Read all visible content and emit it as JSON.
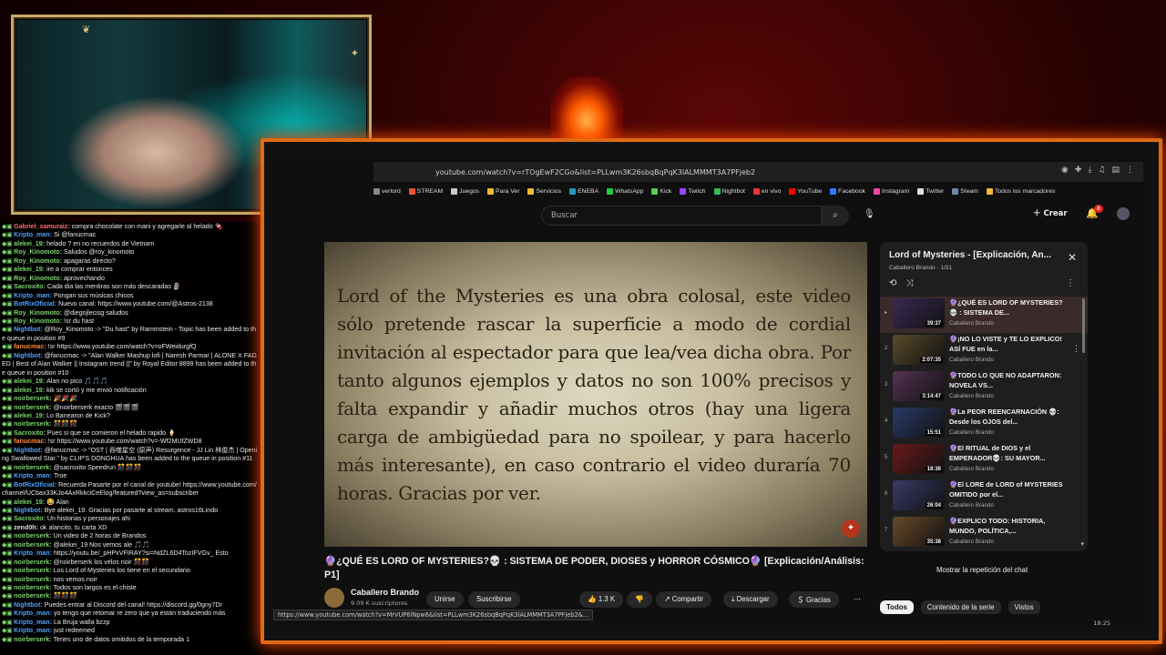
{
  "colors": {
    "accent_border": "#e06a14",
    "yt_red": "#e62117",
    "chat_badge": "#7dd36e"
  },
  "browser": {
    "url": "youtube.com/watch?v=rTOgEwF2CGo&list=PLLwm3K26sbqBqPqK3lALMMMT3A7PFjeb2",
    "bookmarks": [
      "verlord",
      "STREAM",
      "Juegos",
      "Para Ver",
      "Servicios",
      "ENEBA",
      "WhatsApp",
      "Kick",
      "Twitch",
      "Nightbot",
      "en vivo",
      "YouTube",
      "Facebook",
      "Instagram",
      "Twitter",
      "Steam",
      "Todos los marcadores"
    ],
    "status_url": "https://www.youtube.com/watch?v=MrVUP6lNpw6&list=PLLwm3K26sbqBqPqK3lALMMMT3A7PFjeb2&...",
    "clock": "18:25"
  },
  "yt": {
    "search_placeholder": "Buscar",
    "create_label": "Crear",
    "notif_count": "8",
    "video_overlay_text": "Lord of the Mysteries es una obra colosal, este video sólo pretende rascar la superficie a modo de cordial invitación al espectador para que lea/vea dicha obra. Por tanto algunos ejemplos y datos no son 100% precisos y falta expandir y añadir muchos otros (hay una ligera carga de ambigüedad para no spoilear, y para hacerlo más interesante), en caso contrario el video duraría 70 horas. Gracias por ver.",
    "video_title": "🔮¿QUÉ ES LORD OF MYSTERIES?💀 : SISTEMA DE PODER, DIOSES y HORROR CÓSMICO🔮 [Explicación/Análisis: P1]",
    "channel": "Caballero Brando",
    "subscribers": "9.09 K suscriptores",
    "join_label": "Unirse",
    "subscribe_label": "Suscribirse",
    "likes": "1.3 K",
    "share_label": "Compartir",
    "download_label": "Descargar",
    "thanks_label": "Gracias",
    "chat_replay_label": "Mostrar la repetición del chat",
    "chips": [
      "Todos",
      "Contenido de la serie",
      "Vistos"
    ]
  },
  "playlist": {
    "title": "Lord of Mysteries - [Explicación, An...",
    "subtitle": "Caballero Brando - 1/31",
    "items": [
      {
        "idx": "▸",
        "title": "🔮¿QUÉ ES LORD OF MYSTERIES?💀 : SISTEMA DE...",
        "channel": "Caballero Brando",
        "duration": "39:37",
        "thumb": "#3a2a55"
      },
      {
        "idx": "2",
        "title": "🔮¡NO LO VISTE y TE LO EXPLICO! ASÍ FUE en la...",
        "channel": "Caballero Brando",
        "duration": "2:07:35",
        "thumb": "#5a4a2a"
      },
      {
        "idx": "3",
        "title": "🔮TODO LO QUE NO ADAPTARON: NOVELA VS...",
        "channel": "Caballero Brando",
        "duration": "3:14:47",
        "thumb": "#553355"
      },
      {
        "idx": "4",
        "title": "🔮La PEOR REENCARNACIÓN 💀: Desde los OJOS del...",
        "channel": "Caballero Brando",
        "duration": "15:51",
        "thumb": "#2a3a66"
      },
      {
        "idx": "5",
        "title": "🔮El RITUAL de DIOS y el EMPERADOR💀: SU MAYOR...",
        "channel": "Caballero Brando",
        "duration": "18:36",
        "thumb": "#6a1a1a"
      },
      {
        "idx": "6",
        "title": "🔮El LORE de LORD of MYSTERIES OMITIDO por el...",
        "channel": "Caballero Brando",
        "duration": "26:04",
        "thumb": "#3a3a6a"
      },
      {
        "idx": "7",
        "title": "🔮EXPLICO TODO: HISTORIA, MUNDO, POLÍTICA,...",
        "channel": "Caballero Brando",
        "duration": "35:38",
        "thumb": "#6a4a2a"
      }
    ]
  },
  "chat": [
    {
      "user": "Gabriel_samuraiz:",
      "color": "#ff6a6a",
      "msg": "compra chocolate con mani y agregarle al helado 🍫"
    },
    {
      "user": "Kripto_man:",
      "color": "#4ea3ff",
      "msg": "Si @fanucmac"
    },
    {
      "user": "alekei_19:",
      "color": "#7dd36e",
      "msg": "helado ? en no recuerdos de Vietnam"
    },
    {
      "user": "Roy_Kinomoto:",
      "color": "#7dd36e",
      "msg": "Saludos @roy_kinomoto"
    },
    {
      "user": "Roy_Kinomoto:",
      "color": "#7dd36e",
      "msg": "apagaras directo?"
    },
    {
      "user": "alekei_19:",
      "color": "#7dd36e",
      "msg": "ire a comprar entonces"
    },
    {
      "user": "Roy_Kinomoto:",
      "color": "#7dd36e",
      "msg": "aprovechando"
    },
    {
      "user": "Sacroxito:",
      "color": "#7dd36e",
      "msg": "Cada dia las mentiras son más descaradas 🗿"
    },
    {
      "user": "Kripto_man:",
      "color": "#4ea3ff",
      "msg": "Pongan sus músicas chicos"
    },
    {
      "user": "BotRixOficial:",
      "color": "#4ea3ff",
      "msg": "Nuevo canal: https://www.youtube.com/@Astros-2138"
    },
    {
      "user": "Roy_Kinomoto:",
      "color": "#7dd36e",
      "msg": "@diegojlecisg saludos"
    },
    {
      "user": "Roy_Kinomoto:",
      "color": "#7dd36e",
      "msg": "!sr du hast"
    },
    {
      "user": "Nightbot:",
      "color": "#4ea3ff",
      "msg": "@Roy_Kinomoto -> \"Du hast\" by Rammstein - Topic has been added to the queue in position #9"
    },
    {
      "user": "fanucmac:",
      "color": "#ff8a3a",
      "msg": "!sr https://www.youtube.com/watch?v=oFWeidurgfQ"
    },
    {
      "user": "Nightbot:",
      "color": "#4ea3ff",
      "msg": "@fanucmac -> \"Alan Walker Mashup lofi | Naresh Parmar | ALONE X FADED | Best of Alan Walker || Instagram trend ||\" by Royal Editor 8899 has been added to the queue in position #10"
    },
    {
      "user": "alekei_19:",
      "color": "#7dd36e",
      "msg": "Alan no pico 🎵🎵🎵"
    },
    {
      "user": "alekei_19:",
      "color": "#7dd36e",
      "msg": "kik se cortó y me envió notificación"
    },
    {
      "user": "noirberserk:",
      "color": "#7dd36e",
      "msg": "🎉🎉🎉"
    },
    {
      "user": "noirberserk:",
      "color": "#7dd36e",
      "msg": "@noirberserk exacto 🎬🎬🎬"
    },
    {
      "user": "alekei_19:",
      "color": "#7dd36e",
      "msg": "Lo Banearon de Kick?"
    },
    {
      "user": "noirberserk:",
      "color": "#7dd36e",
      "msg": "🎊🎊🎊"
    },
    {
      "user": "Sacroxito:",
      "color": "#7dd36e",
      "msg": "Pues si que se comieron el helado rapido 🍦"
    },
    {
      "user": "fanucmac:",
      "color": "#ff8a3a",
      "msg": "!sr https://www.youtube.com/watch?v=-Wf2MUfZWD8"
    },
    {
      "user": "Nightbot:",
      "color": "#4ea3ff",
      "msg": "@fanucmac -> \"OST | 吞噬星空 (原声) Resurgence - JJ Lin 林俊杰 | Opening Swallowed Star.\" by CLIP'S DONGHUA has been added to the queue in position #11"
    },
    {
      "user": "noirberserk:",
      "color": "#7dd36e",
      "msg": "@sacroxito Speedrun 🎊🎊🎊"
    },
    {
      "user": "Kripto_man:",
      "color": "#4ea3ff",
      "msg": "Troe"
    },
    {
      "user": "BotRixOficial:",
      "color": "#4ea3ff",
      "msg": "Recuerda Pasarte por el canal de youtube! https://www.youtube.com/channel/UCbax33KJo4AxRkkciCeElog/featured?view_as=subscriber"
    },
    {
      "user": "alekei_19:",
      "color": "#7dd36e",
      "msg": "😂 Alan"
    },
    {
      "user": "Nightbot:",
      "color": "#4ea3ff",
      "msg": "Bye alekei_19. Gracias por pasarte al stream. astros16Lindo"
    },
    {
      "user": "Sacroxito:",
      "color": "#7dd36e",
      "msg": "Un historias y personajes ahi"
    },
    {
      "user": "zend0h:",
      "color": "#dddddd",
      "msg": "ok alancito, tu carta XD"
    },
    {
      "user": "noirberserk:",
      "color": "#7dd36e",
      "msg": "Un video de 2 horas de Brandos"
    },
    {
      "user": "noirberserk:",
      "color": "#7dd36e",
      "msg": "@alekei_19 Nos vemos ale 🎵🎵"
    },
    {
      "user": "Kripto_man:",
      "color": "#4ea3ff",
      "msg": "https://youtu.be/_pHPxVFIRAY?si=NdZL6D4TozIFVGv_ Esto"
    },
    {
      "user": "noirberserk:",
      "color": "#7dd36e",
      "msg": "@noirberserk los vélos noir 🎊🎊"
    },
    {
      "user": "noirberserk:",
      "color": "#7dd36e",
      "msg": "Los Lord of Mysteries los tiene en el secundario"
    },
    {
      "user": "noirberserk:",
      "color": "#7dd36e",
      "msg": "nos vemos noir"
    },
    {
      "user": "noirberserk:",
      "color": "#7dd36e",
      "msg": "Todos son largos es el chiste"
    },
    {
      "user": "noirberserk:",
      "color": "#7dd36e",
      "msg": "🎊🎊🎊"
    },
    {
      "user": "Nightbot:",
      "color": "#4ea3ff",
      "msg": "Puedes entrar al Discord del canal! https://discord.gg/0gny7Dr"
    },
    {
      "user": "Kripto_man:",
      "color": "#4ea3ff",
      "msg": "yo tengo que retomar re zero que ya están traduciendo más"
    },
    {
      "user": "Kripto_man:",
      "color": "#4ea3ff",
      "msg": "La Bruja walla bzzp"
    },
    {
      "user": "Kripto_man:",
      "color": "#4ea3ff",
      "msg": "just redeemed"
    },
    {
      "user": "noirberserk:",
      "color": "#7dd36e",
      "msg": "Tenes uno de datos omitidos de la temporada 1"
    }
  ]
}
